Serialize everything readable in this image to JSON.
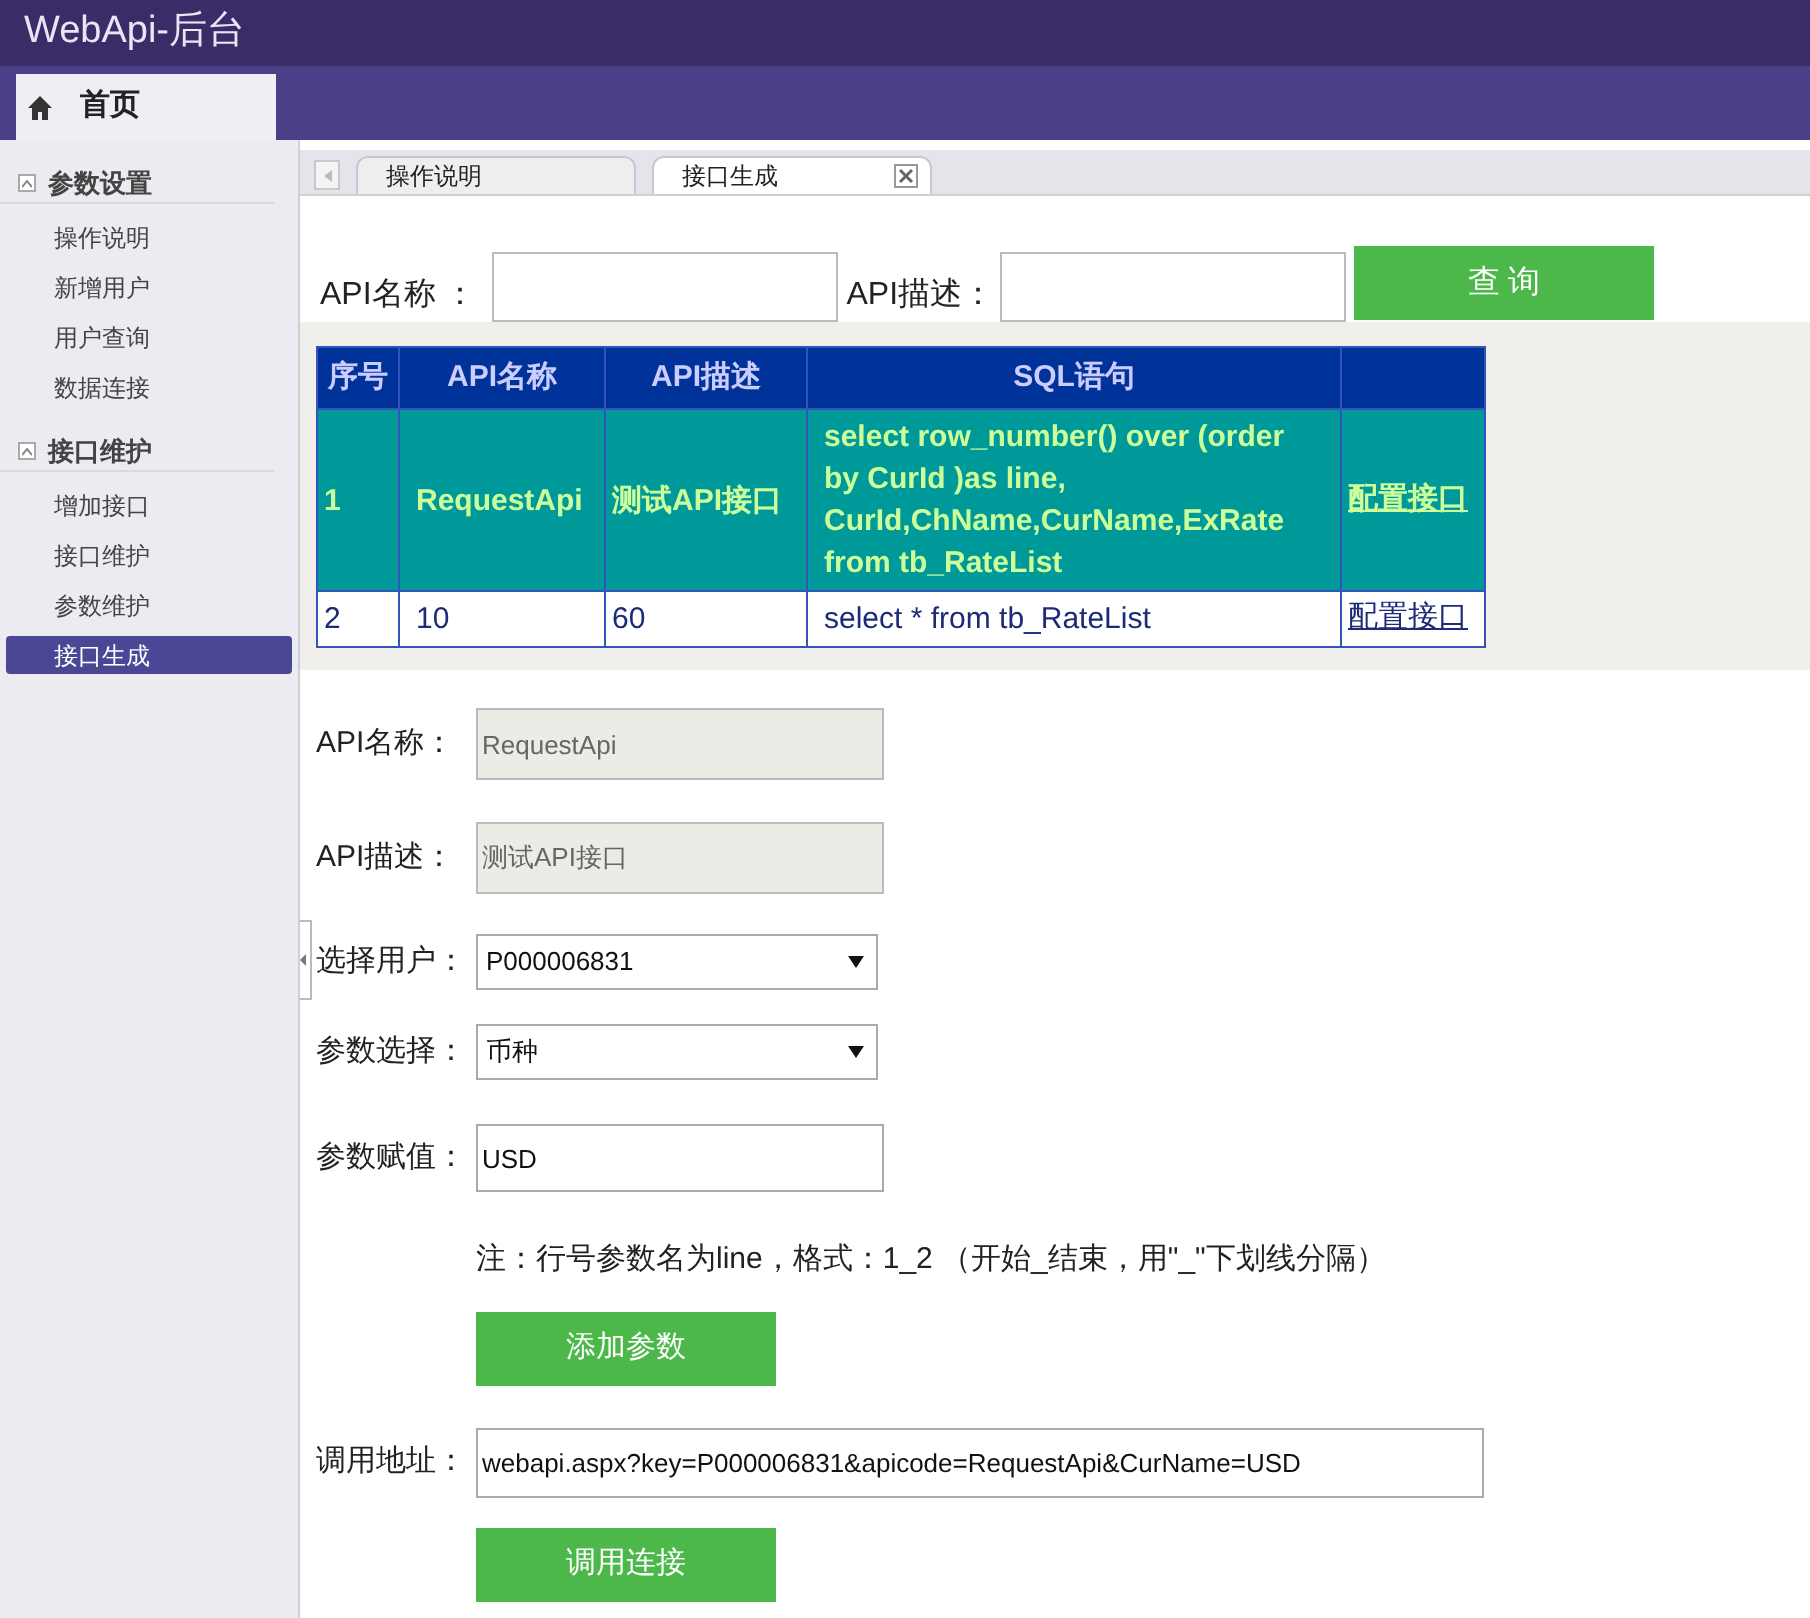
{
  "app_title": "WebApi-后台",
  "top_tabs": [
    {
      "label": "首页",
      "selected": true
    }
  ],
  "sidebar": [
    {
      "title": "参数设置",
      "expanded": true,
      "items": [
        {
          "label": "操作说明",
          "selected": false
        },
        {
          "label": "新增用户",
          "selected": false
        },
        {
          "label": "用户查询",
          "selected": false
        },
        {
          "label": "数据连接",
          "selected": false
        }
      ]
    },
    {
      "title": "接口维护",
      "expanded": true,
      "items": [
        {
          "label": "增加接口",
          "selected": false
        },
        {
          "label": "接口维护",
          "selected": false
        },
        {
          "label": "参数维护",
          "selected": false
        },
        {
          "label": "接口生成",
          "selected": true
        }
      ]
    }
  ],
  "tabs": [
    {
      "label": "操作说明",
      "selected": false,
      "closable": false
    },
    {
      "label": "接口生成",
      "selected": true,
      "closable": true
    }
  ],
  "search": {
    "fields": [
      {
        "label": "API名称 ："
      },
      {
        "label": "API描述："
      }
    ],
    "button": "查 询"
  },
  "table": {
    "columns": [
      "序号",
      "API名称",
      "API描述",
      "SQL语句"
    ],
    "rows": [
      {
        "selected": true,
        "cells": [
          "1",
          "RequestApi",
          "测试API接口",
          "select row_number() over (order by CurId )as line, CurId,ChName,CurName,ExRate from tb_RateList"
        ],
        "action": "配置接口"
      },
      {
        "selected": false,
        "cells": [
          "2",
          "10",
          "60",
          "select * from tb_RateList"
        ],
        "action": "配置接口"
      }
    ]
  },
  "form": {
    "rows": [
      {
        "kind": "text",
        "label": "API名称：",
        "value": "RequestApi",
        "disabled": true
      },
      {
        "kind": "text",
        "label": "API描述：",
        "value": "测试API接口",
        "disabled": true
      },
      {
        "kind": "select",
        "label": "选择用户：",
        "value": "P000006831",
        "disabled": false
      },
      {
        "kind": "select",
        "label": "参数选择：",
        "value": "币种",
        "disabled": false
      },
      {
        "kind": "text",
        "label": "参数赋值：",
        "value": "USD",
        "disabled": false
      }
    ],
    "note": "注：行号参数名为line，格式：1_2 （开始_结束，用\"_\"下划线分隔）",
    "add_button": "添加参数",
    "address": {
      "label": "调用地址：",
      "value": "webapi.aspx?key=P000006831&apicode=RequestApi&CurName=USD"
    },
    "call_button": "调用连接"
  }
}
